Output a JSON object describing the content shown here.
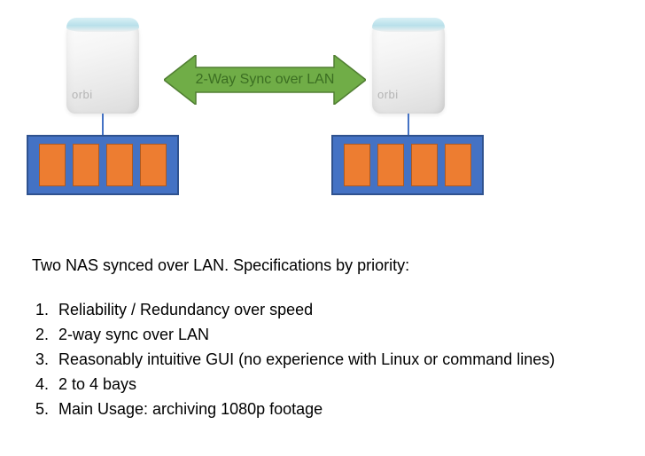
{
  "diagram": {
    "device_brand": "orbi",
    "arrow_label": "2-Way Sync over LAN",
    "nas_bay_count": 4,
    "colors": {
      "nas_fill": "#4472c4",
      "nas_border": "#2f528f",
      "bay_fill": "#ed7d31",
      "bay_border": "#ae5a21",
      "arrow_fill": "#70ad47",
      "arrow_border": "#507e32",
      "arrow_text": "#3b6e22"
    }
  },
  "text": {
    "heading": "Two NAS synced over LAN. Specifications by priority:",
    "specs": [
      "Reliability / Redundancy over speed",
      "2-way sync over LAN",
      "Reasonably intuitive GUI (no experience with Linux or command lines)",
      "2 to 4 bays",
      "Main Usage: archiving 1080p footage"
    ]
  }
}
